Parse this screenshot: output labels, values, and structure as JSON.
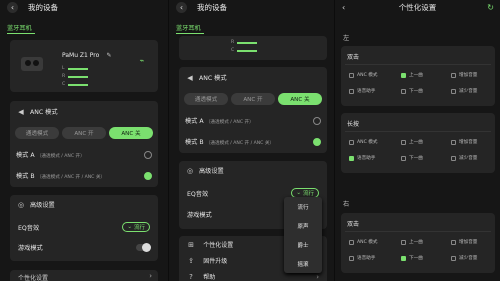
{
  "panel1": {
    "title": "我的设备",
    "tab": "蓝牙耳机",
    "device_name": "PaMu Z1 Pro",
    "battery_left": "L",
    "battery_right": "R",
    "battery_case": "C",
    "anc": {
      "title": "ANC 模式",
      "segments": [
        "通透模式",
        "ANC 开",
        "ANC 关"
      ],
      "modes": [
        {
          "label": "模式 A",
          "desc": "（通透模式 / ANC 开）",
          "selected": false
        },
        {
          "label": "模式 B",
          "desc": "（通透模式 / ANC 开 / ANC 关）",
          "selected": true
        }
      ]
    },
    "advanced": {
      "title": "高级设置",
      "eq_label": "EQ音效",
      "eq_value": "流行",
      "game_label": "游戏模式"
    },
    "bottom_item": "个性化设置"
  },
  "panel2": {
    "tab": "蓝牙耳机",
    "battery_right": "R",
    "battery_case": "C",
    "anc": {
      "title": "ANC 模式",
      "segments": [
        "通透模式",
        "ANC 开",
        "ANC 关"
      ],
      "modes": [
        {
          "label": "模式 A",
          "desc": "（通透模式 / ANC 开）",
          "selected": false
        },
        {
          "label": "模式 B",
          "desc": "（通透模式 / ANC 开 / ANC 关）",
          "selected": true
        }
      ]
    },
    "advanced": {
      "title": "高级设置",
      "eq_label": "EQ音效",
      "eq_value": "流行",
      "game_label": "游戏模式"
    },
    "dropdown_options": [
      "流行",
      "原声",
      "爵士",
      "摇滚"
    ],
    "list": [
      "个性化设置",
      "固件升级",
      "帮助"
    ]
  },
  "panel3": {
    "title": "个性化设置",
    "left_label": "左",
    "right_label": "右",
    "sections": [
      {
        "name": "双击",
        "options": [
          {
            "label": "ANC 模式",
            "on": false
          },
          {
            "label": "上一曲",
            "on": true
          },
          {
            "label": "增加音量",
            "on": false
          },
          {
            "label": "语音助手",
            "on": false
          },
          {
            "label": "下一曲",
            "on": false
          },
          {
            "label": "减少音量",
            "on": false
          }
        ]
      },
      {
        "name": "长按",
        "options": [
          {
            "label": "ANC 模式",
            "on": false
          },
          {
            "label": "上一曲",
            "on": false
          },
          {
            "label": "增加音量",
            "on": false
          },
          {
            "label": "语音助手",
            "on": true
          },
          {
            "label": "下一曲",
            "on": false
          },
          {
            "label": "减少音量",
            "on": false
          }
        ]
      },
      {
        "name": "双击",
        "options": [
          {
            "label": "ANC 模式",
            "on": false
          },
          {
            "label": "上一曲",
            "on": false
          },
          {
            "label": "增加音量",
            "on": false
          },
          {
            "label": "语音助手",
            "on": false
          },
          {
            "label": "下一曲",
            "on": true
          },
          {
            "label": "减少音量",
            "on": false
          }
        ]
      }
    ]
  },
  "colors": {
    "accent": "#7be06f",
    "card": "#252525",
    "background": "#161616"
  }
}
